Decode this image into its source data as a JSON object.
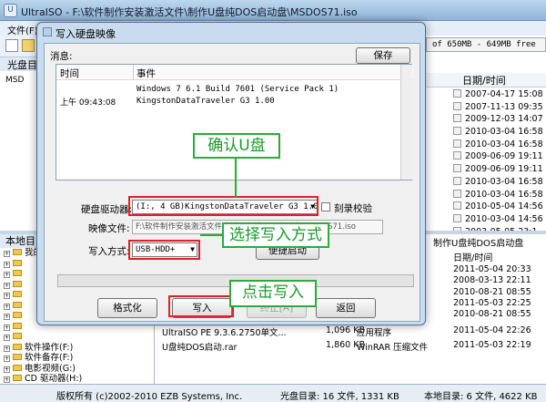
{
  "window": {
    "title": "UltraISO - F:\\软件制作安装激活文件\\制作U盘纯DOS启动盘\\MSDOS71.iso",
    "menu_first": "文件(F)",
    "left_header": "光盘目",
    "left_item": "MSD",
    "size_info": "of 650MB - 649MB free",
    "right_col_header": "日期/时间",
    "right_dates": [
      "2007-04-17 15:08",
      "2007-11-13 09:35",
      "2009-12-03 14:07",
      "2010-03-04 16:58",
      "2010-03-04 16:58",
      "2009-06-09 19:11",
      "2009-06-09 19:11",
      "2010-03-04 16:58",
      "2010-03-04 16:58",
      "2010-05-04 14:56",
      "2010-03-04 14:56",
      "2003-05-05 23:1"
    ]
  },
  "local": {
    "header": "本地目",
    "tree": [
      "我的",
      "",
      "",
      "",
      "",
      "",
      "",
      "",
      "",
      "软件操作(F:)",
      "软件备存(F:)",
      "电影视频(G:)",
      "CD 驱动器(H:)",
      "(I:)"
    ],
    "right_header": "制作U盘纯DOS启动盘",
    "right_col_header": "日期/时间",
    "right_dates": [
      "2011-05-04 20:33",
      "2008-03-13 22:11",
      "2010-08-21 08:55",
      "2011-05-03 22:25",
      "2010-08-21 08:55"
    ],
    "files": [
      {
        "name": "UltraISO PE 9.3.6.2750单文...",
        "size": "1,096 KB",
        "type": "应用程序",
        "date": "2011-05-04 22:26"
      },
      {
        "name": "U盘纯DOS启动.rar",
        "size": "1,860 KB",
        "type": "WinRAR 压缩文件",
        "date": "2011-05-03 22:19"
      }
    ]
  },
  "status": {
    "copyright": "版权所有 (c)2002-2010 EZB Systems, Inc.",
    "disc": "光盘目录: 16 文件, 1331 KB",
    "local": "本地目录: 6 文件, 4622 KB"
  },
  "dialog": {
    "title": "写入硬盘映像",
    "message_label": "消息:",
    "save_button": "保存",
    "col_time": "时间",
    "col_event": "事件",
    "log": [
      {
        "time": "",
        "event": "Windows 7 6.1 Build 7601 (Service Pack 1)"
      },
      {
        "time": "上午 09:43:08",
        "event": "KingstonDataTraveler G3 1.00"
      }
    ],
    "drive_label": "硬盘驱动器:",
    "drive_value": "(I:, 4 GB)KingstonDataTraveler G3 1.00",
    "verify_label": "刻录校验",
    "image_label": "映像文件:",
    "image_value": "F:\\软件制作安装激活文件\\制作U盘纯DOS启动盘\\MSDOS71.iso",
    "method_label": "写入方式:",
    "method_value": "USB-HDD+",
    "boot_button": "便捷启动",
    "format_button": "格式化",
    "write_button": "写入",
    "stop_button": "终止[A]",
    "back_button": "返回",
    "progress": 0
  },
  "annotations": {
    "confirm_usb": "确认U盘",
    "choose_method": "选择写入方式",
    "click_write": "点击写入"
  },
  "colors": {
    "annotation_red": "#e0202a",
    "annotation_green": "#2eaa3a"
  }
}
